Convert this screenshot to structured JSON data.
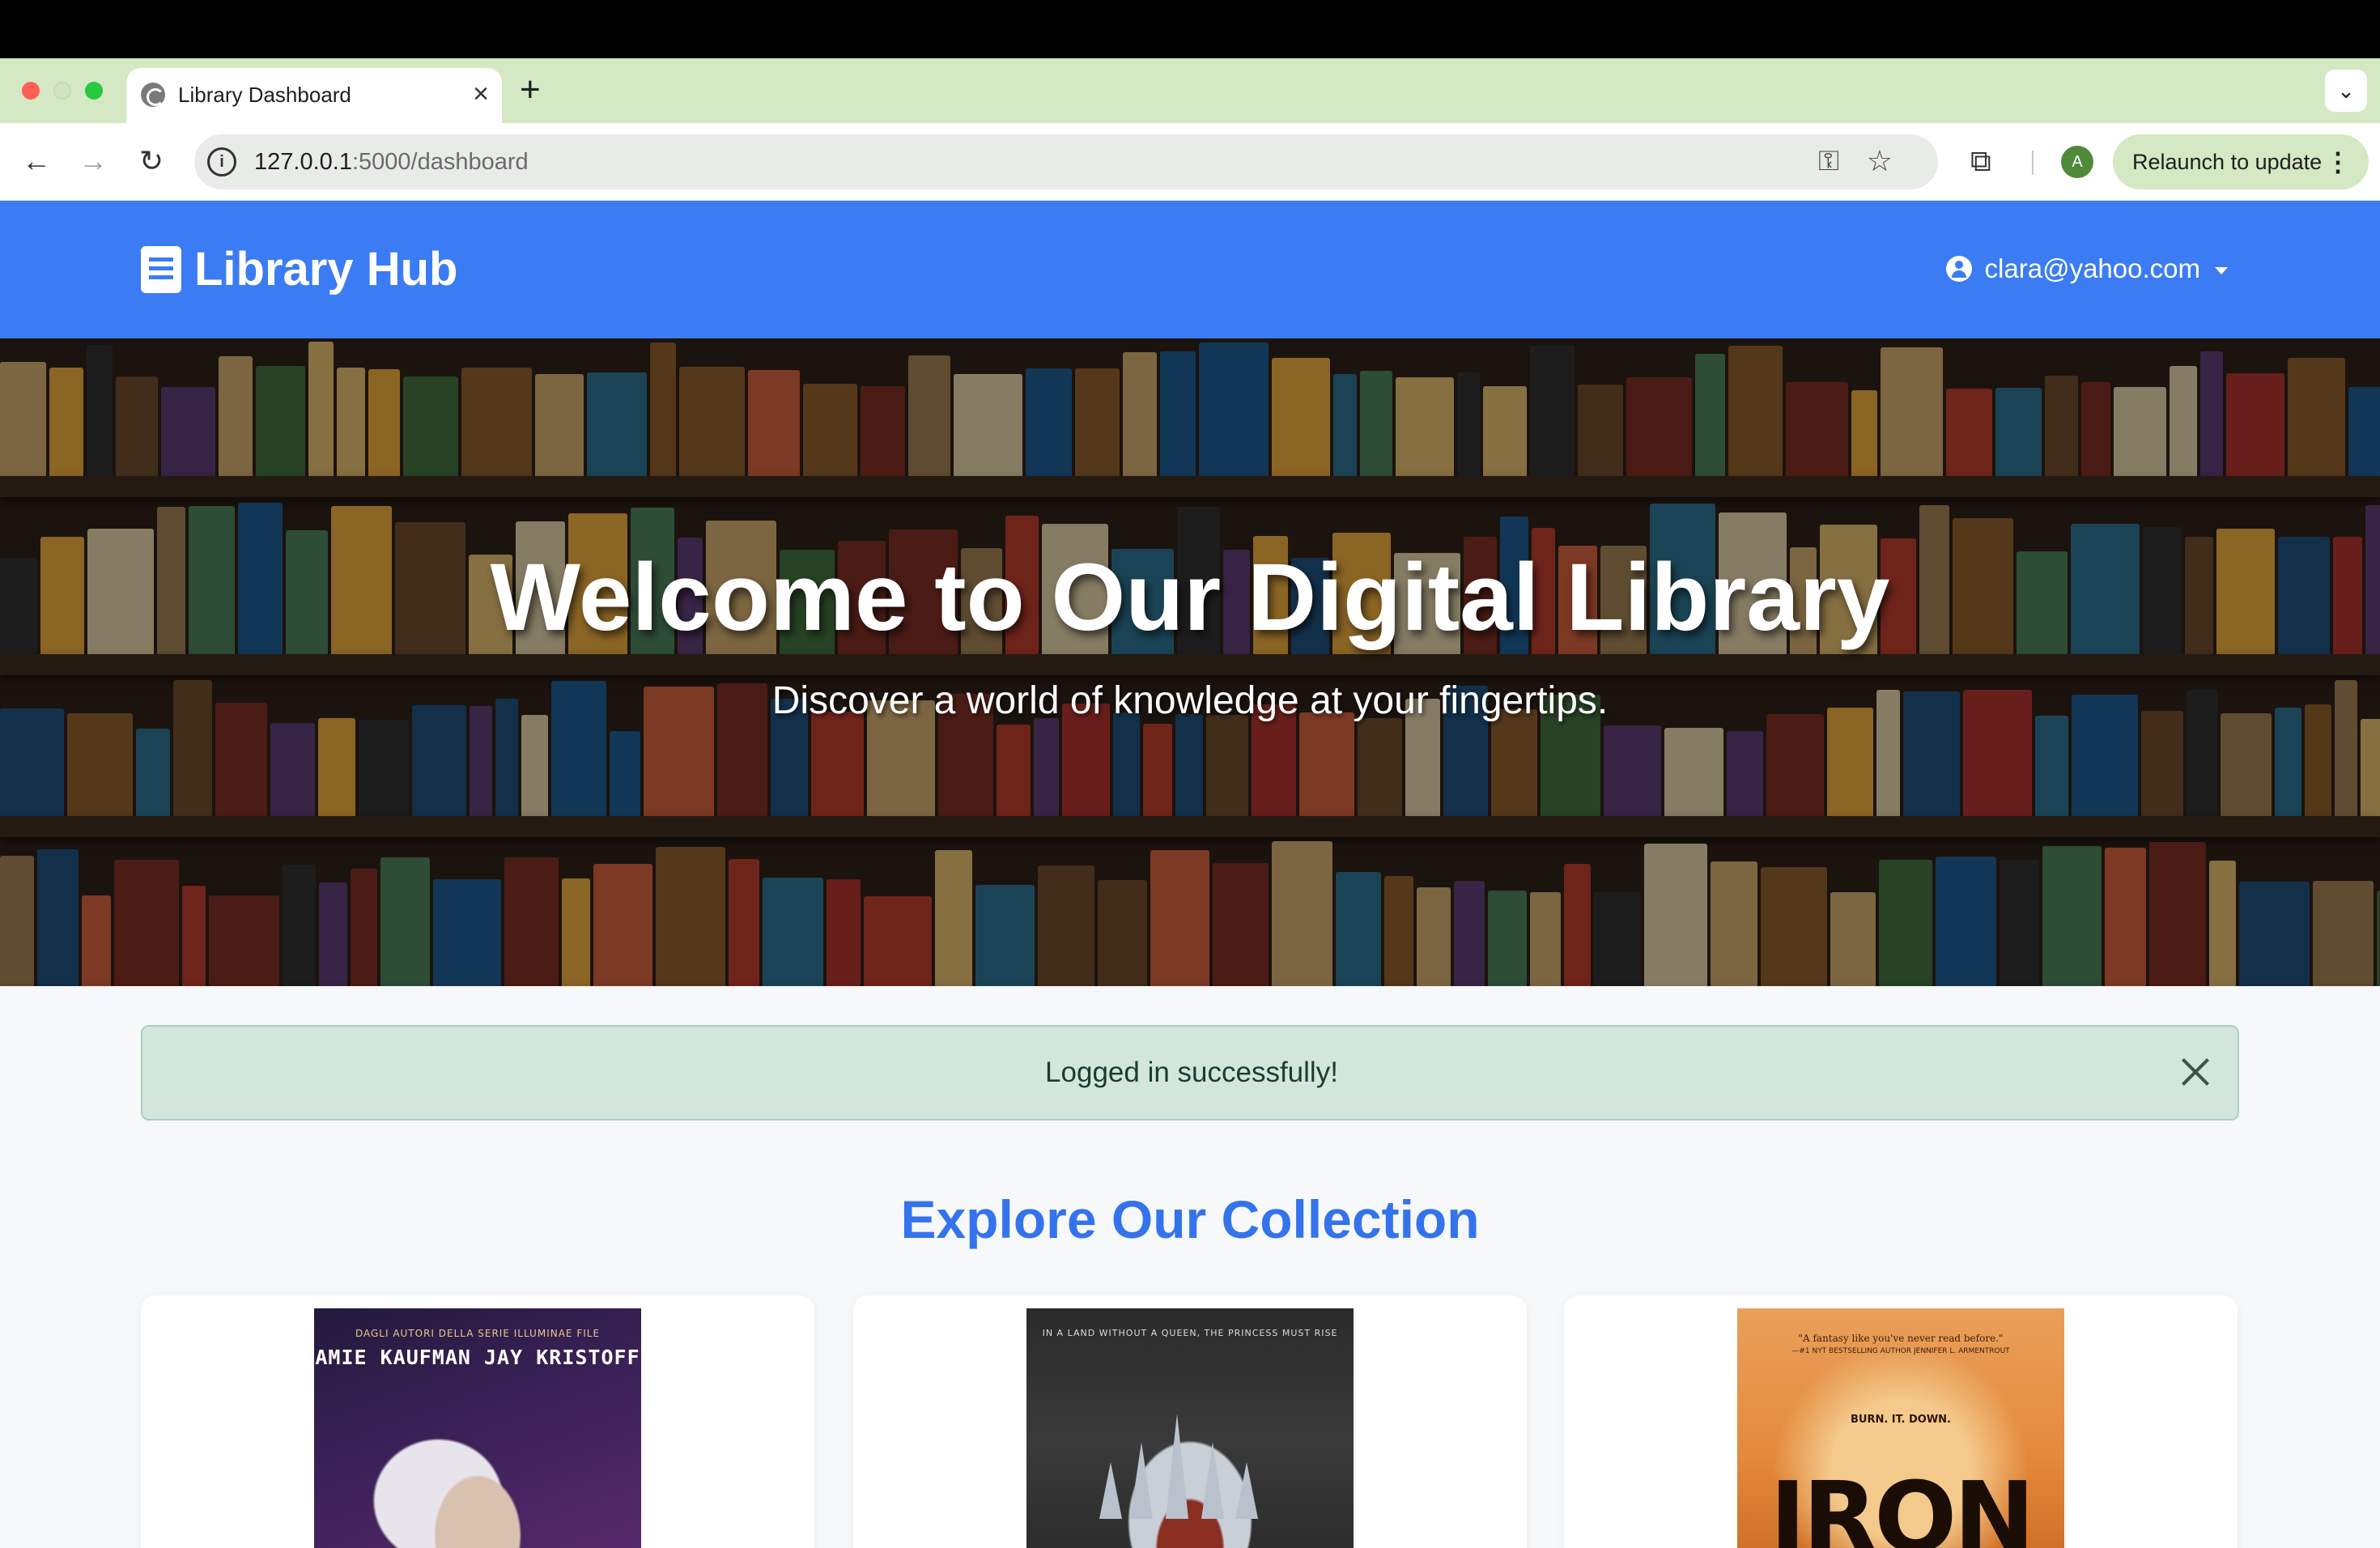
{
  "browser": {
    "tab_title": "Library Dashboard",
    "url_host": "127.0.0.1",
    "url_path": ":5000/dashboard",
    "profile_initial": "A",
    "relaunch_label": "Relaunch to update"
  },
  "navbar": {
    "brand": "Library Hub",
    "user_email": "clara@yahoo.com"
  },
  "hero": {
    "title": "Welcome to Our Digital Library",
    "subtitle": "Discover a world of knowledge at your fingertips."
  },
  "alert": {
    "message": "Logged in successfully!"
  },
  "collection": {
    "title": "Explore Our Collection",
    "books": [
      {
        "cover_tagline": "DAGLI AUTORI DELLA SERIE ILLUMINAE FILE",
        "cover_authors": "AMIE KAUFMAN  JAY KRISTOFF"
      },
      {
        "cover_tagline": "IN A LAND WITHOUT A QUEEN, THE PRINCESS MUST RISE"
      },
      {
        "cover_quote": "\"A fantasy like you've never read before.\"",
        "cover_quote_attr": "—#1 NYT BESTSELLING AUTHOR JENNIFER L. ARMENTROUT",
        "cover_tagline": "BURN. IT. DOWN.",
        "cover_title": "IRON"
      }
    ]
  },
  "colors": {
    "navbar": "#3b7cf4",
    "accent": "#3573ec",
    "alert_bg": "#d2e6dd",
    "chrome_tabstrip": "#d4e8c3"
  }
}
